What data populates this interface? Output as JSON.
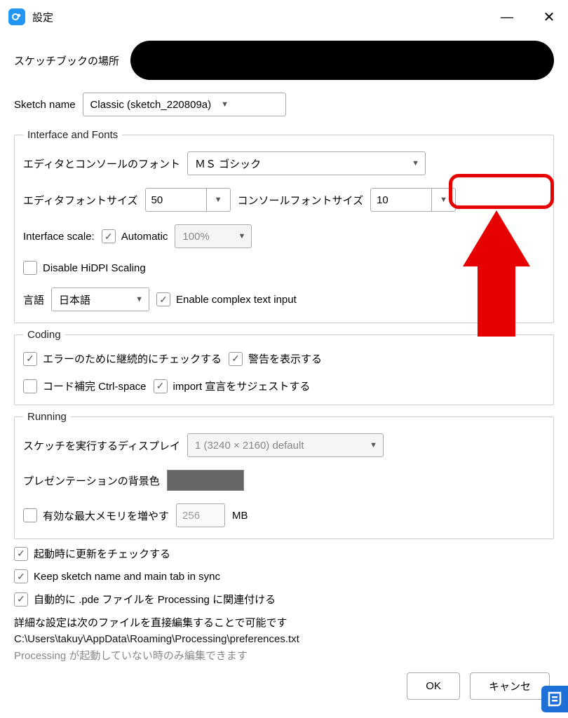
{
  "window": {
    "title": "設定",
    "minimize": "—",
    "close": "✕"
  },
  "sketchbook": {
    "label": "スケッチブックの場所"
  },
  "sketch_name": {
    "label": "Sketch name",
    "value": "Classic (sketch_220809a)"
  },
  "interface_fonts": {
    "legend": "Interface and Fonts",
    "editor_console_font_label": "エディタとコンソールのフォント",
    "editor_console_font_value": "ＭＳ ゴシック",
    "editor_font_size_label": "エディタフォントサイズ",
    "editor_font_size_value": "50",
    "console_font_size_label": "コンソールフォントサイズ",
    "console_font_size_value": "10",
    "interface_scale_label": "Interface scale:",
    "automatic_label": "Automatic",
    "automatic_checked": true,
    "scale_value": "100%",
    "disable_hidpi_label": "Disable HiDPI Scaling",
    "disable_hidpi_checked": false,
    "language_label": "言語",
    "language_value": "日本語",
    "complex_text_label": "Enable complex text input",
    "complex_text_checked": true
  },
  "coding": {
    "legend": "Coding",
    "continuous_error_label": "エラーのために継続的にチェックする",
    "continuous_error_checked": true,
    "show_warnings_label": "警告を表示する",
    "show_warnings_checked": true,
    "code_completion_label": "コード補完 Ctrl-space",
    "code_completion_checked": false,
    "import_suggest_label": "import 宣言をサジェストする",
    "import_suggest_checked": true
  },
  "running": {
    "legend": "Running",
    "display_label": "スケッチを実行するディスプレイ",
    "display_value": "1 (3240 × 2160) default",
    "presentation_bg_label": "プレゼンテーションの背景色",
    "presentation_bg_color": "#666666",
    "max_memory_label": "有効な最大メモリを増やす",
    "max_memory_checked": false,
    "max_memory_value": "256",
    "mb_label": "MB"
  },
  "misc": {
    "check_updates_label": "起動時に更新をチェックする",
    "check_updates_checked": true,
    "keep_sync_label": "Keep sketch name and main tab in sync",
    "keep_sync_checked": true,
    "associate_pde_label": "自動的に .pde ファイルを Processing に関連付ける",
    "associate_pde_checked": true
  },
  "footer": {
    "line1": "詳細な設定は次のファイルを直接編集することで可能です",
    "path": "C:\\Users\\takuy\\AppData\\Roaming\\Processing\\preferences.txt",
    "note": "Processing が起動していない時のみ編集できます"
  },
  "buttons": {
    "ok": "OK",
    "cancel": "キャンセ"
  },
  "annotation": {
    "highlight_target": "console_font_size",
    "arrow_color": "#e60000"
  }
}
